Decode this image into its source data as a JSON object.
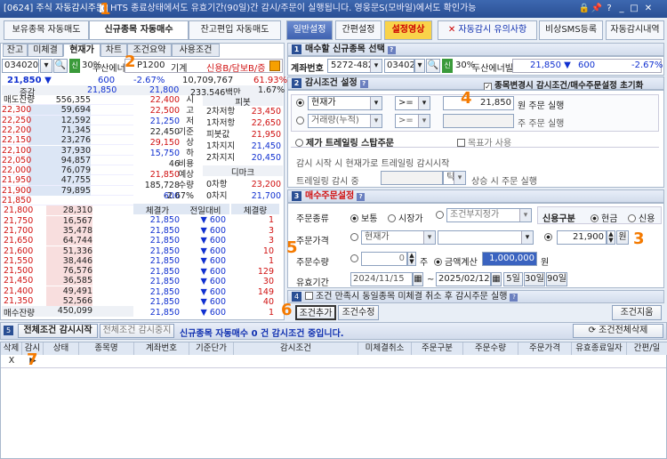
{
  "title": {
    "code": "[0624] 주식 자동감시주문",
    "notice": "HTS 종료상태에서도 유효기간(90일)간 감시/주문이 실행됩니다. 영웅문S(모바일)에서도 확인가능"
  },
  "top_tabs": [
    "보유종목 자동매도",
    "신규종목 자동매수",
    "잔고편입 자동매도"
  ],
  "top_buttons": {
    "general": "일반설정",
    "simple": "간편설정",
    "video": "설정영상",
    "caution": "자동감시 유의사항",
    "sms": "비상SMS등록",
    "history": "자동감시내역"
  },
  "sub_tabs": [
    "잔고",
    "미체결",
    "현재가",
    "차트",
    "조건요약",
    "사용조건"
  ],
  "left_bar": {
    "code": "034020",
    "pct": "30%",
    "name": "두산에너",
    "tag": "P1200",
    "tag2": "기계",
    "credit": "신용B/담보B/증",
    "rate": "61.93%"
  },
  "quote": {
    "price": "21,850",
    "change": "600",
    "rate": "-2.67%",
    "volume": "10,709,767",
    "vol_rate": "61.93%",
    "prev_label": "증감",
    "prev_price": "21,850",
    "prev_price2": "21,800",
    "amount": "233,546백만",
    "amount_rate": "1.67%"
  },
  "orderbook": {
    "head_left": "매도잔량",
    "head_right": "매수잔량",
    "asks": [
      [
        "556,355",
        ""
      ],
      [
        "59,694",
        "22,300"
      ],
      [
        "12,592",
        "22,250"
      ],
      [
        "71,345",
        "22,200"
      ],
      [
        "23,276",
        "22,150"
      ],
      [
        "37,930",
        "22,100"
      ],
      [
        "94,857",
        "22,050"
      ],
      [
        "76,079",
        "22,000"
      ],
      [
        "47,755",
        "21,950"
      ],
      [
        "79,895",
        "21,900"
      ],
      [
        "",
        "21,850"
      ]
    ],
    "bids": [
      [
        "21,800",
        "28,310"
      ],
      [
        "21,750",
        "16,567"
      ],
      [
        "21,700",
        "35,478"
      ],
      [
        "21,650",
        "64,744"
      ],
      [
        "21,600",
        "51,336"
      ],
      [
        "21,550",
        "38,446"
      ],
      [
        "21,500",
        "76,576"
      ],
      [
        "21,450",
        "36,585"
      ],
      [
        "21,400",
        "49,491"
      ],
      [
        "21,350",
        "52,566"
      ]
    ],
    "total_ask": "매수잔량",
    "total_bid": "450,099"
  },
  "info": [
    [
      "22,400",
      "시"
    ],
    [
      "22,500",
      "고"
    ],
    [
      "21,250",
      "저"
    ],
    [
      "22,450",
      "기준"
    ],
    [
      "29,150",
      "상"
    ],
    [
      "15,750",
      "하"
    ],
    [
      "46",
      "비용"
    ],
    [
      "21,850",
      "예상"
    ],
    [
      "185,728",
      "수량"
    ],
    [
      "600",
      "-2.67%"
    ]
  ],
  "pivot": {
    "title": "피봇",
    "rows": [
      [
        "2차저항",
        "23,450"
      ],
      [
        "1차저항",
        "22,650"
      ],
      [
        "피봇값",
        "21,950"
      ],
      [
        "1차지지",
        "21,450"
      ],
      [
        "2차지지",
        "20,450"
      ]
    ],
    "demark_title": "디마크",
    "demark": [
      [
        "0차항",
        "23,200"
      ],
      [
        "0차지",
        "21,700"
      ]
    ]
  },
  "ticks": {
    "headers": [
      "체결가",
      "전일대비",
      "체결량"
    ],
    "rows": [
      [
        "21,850",
        "600",
        "1"
      ],
      [
        "21,850",
        "600",
        "3"
      ],
      [
        "21,850",
        "600",
        "3"
      ],
      [
        "21,850",
        "600",
        "10"
      ],
      [
        "21,850",
        "600",
        "1"
      ],
      [
        "21,850",
        "600",
        "129"
      ],
      [
        "21,850",
        "600",
        "30"
      ],
      [
        "21,850",
        "600",
        "149"
      ],
      [
        "21,850",
        "600",
        "40"
      ],
      [
        "21,850",
        "600",
        "1"
      ]
    ]
  },
  "sec1": {
    "title": "매수할 신규종목 선택",
    "acct_label": "계좌번호",
    "acct": "5272-4825",
    "code": "034020",
    "pct": "30%",
    "name": "두산에너빌",
    "price": "21,850",
    "change": "600",
    "rate": "-2.67%"
  },
  "sec2": {
    "title": "감시조건 설정",
    "reset_chk": "종목변경시 감시조건/매수주문설정 초기화",
    "cond1": "현재가",
    "op1": ">=",
    "val1": "21,850",
    "unit1": "원 주문 실행",
    "cond2": "거래량(누적)",
    "op2": ">=",
    "unit2": "주 주문 실행",
    "trail_title": "제가 트레일링 스탑주문",
    "target": "목표가 사용",
    "trail_desc": "감시 시작 시 현재가로 트레일링 감시시작",
    "trail_label": "트레일링 감시 중",
    "tick": "틱",
    "trail_unit": "상승 시 주문 실행"
  },
  "sec3": {
    "title": "매수주문설정",
    "type_label": "주문종류",
    "normal": "보통",
    "market": "시장가",
    "cond": "조건부지정가",
    "credit_label": "신용구분",
    "cash": "현금",
    "credit": "신용",
    "price_label": "주문가격",
    "price_sel": "현재가",
    "price_val": "21,900",
    "won": "원",
    "qty_label": "주문수량",
    "qty_val": "0",
    "qty_unit": "주",
    "amount_label": "금액계산",
    "amount_val": "1,000,000",
    "amount_unit": "원",
    "valid_label": "유효기간",
    "date_from": "2024/11/15",
    "date_to": "2025/02/12",
    "d5": "5일",
    "d30": "30일",
    "d90": "90일"
  },
  "sec4": {
    "text": "조건 만족시 동일종목 미체결 취소 후 감시주문 실행",
    "add": "조건추가",
    "edit": "조건수정",
    "del": "조건지움"
  },
  "sec5": {
    "all_start": "전체조건 감시시작",
    "all_stop": "전체조건 감시중지",
    "status": "신규종목 자동매수 0 건 감시조건 중입니다.",
    "delete_all": "조건전체삭제",
    "headers": [
      "삭제",
      "감시",
      "상태",
      "종목명",
      "계좌번호",
      "기준단가",
      "감시조건",
      "미체결취소",
      "주문구분",
      "주문수량",
      "주문가격",
      "유효종료일자",
      "간편/일"
    ],
    "row": [
      "X",
      "▶"
    ]
  },
  "badges": [
    "1",
    "2",
    "3",
    "4",
    "5",
    "6",
    "7"
  ],
  "colors": {
    "accent": "#f47a00",
    "red": "#d01010",
    "blue": "#1030d0"
  }
}
